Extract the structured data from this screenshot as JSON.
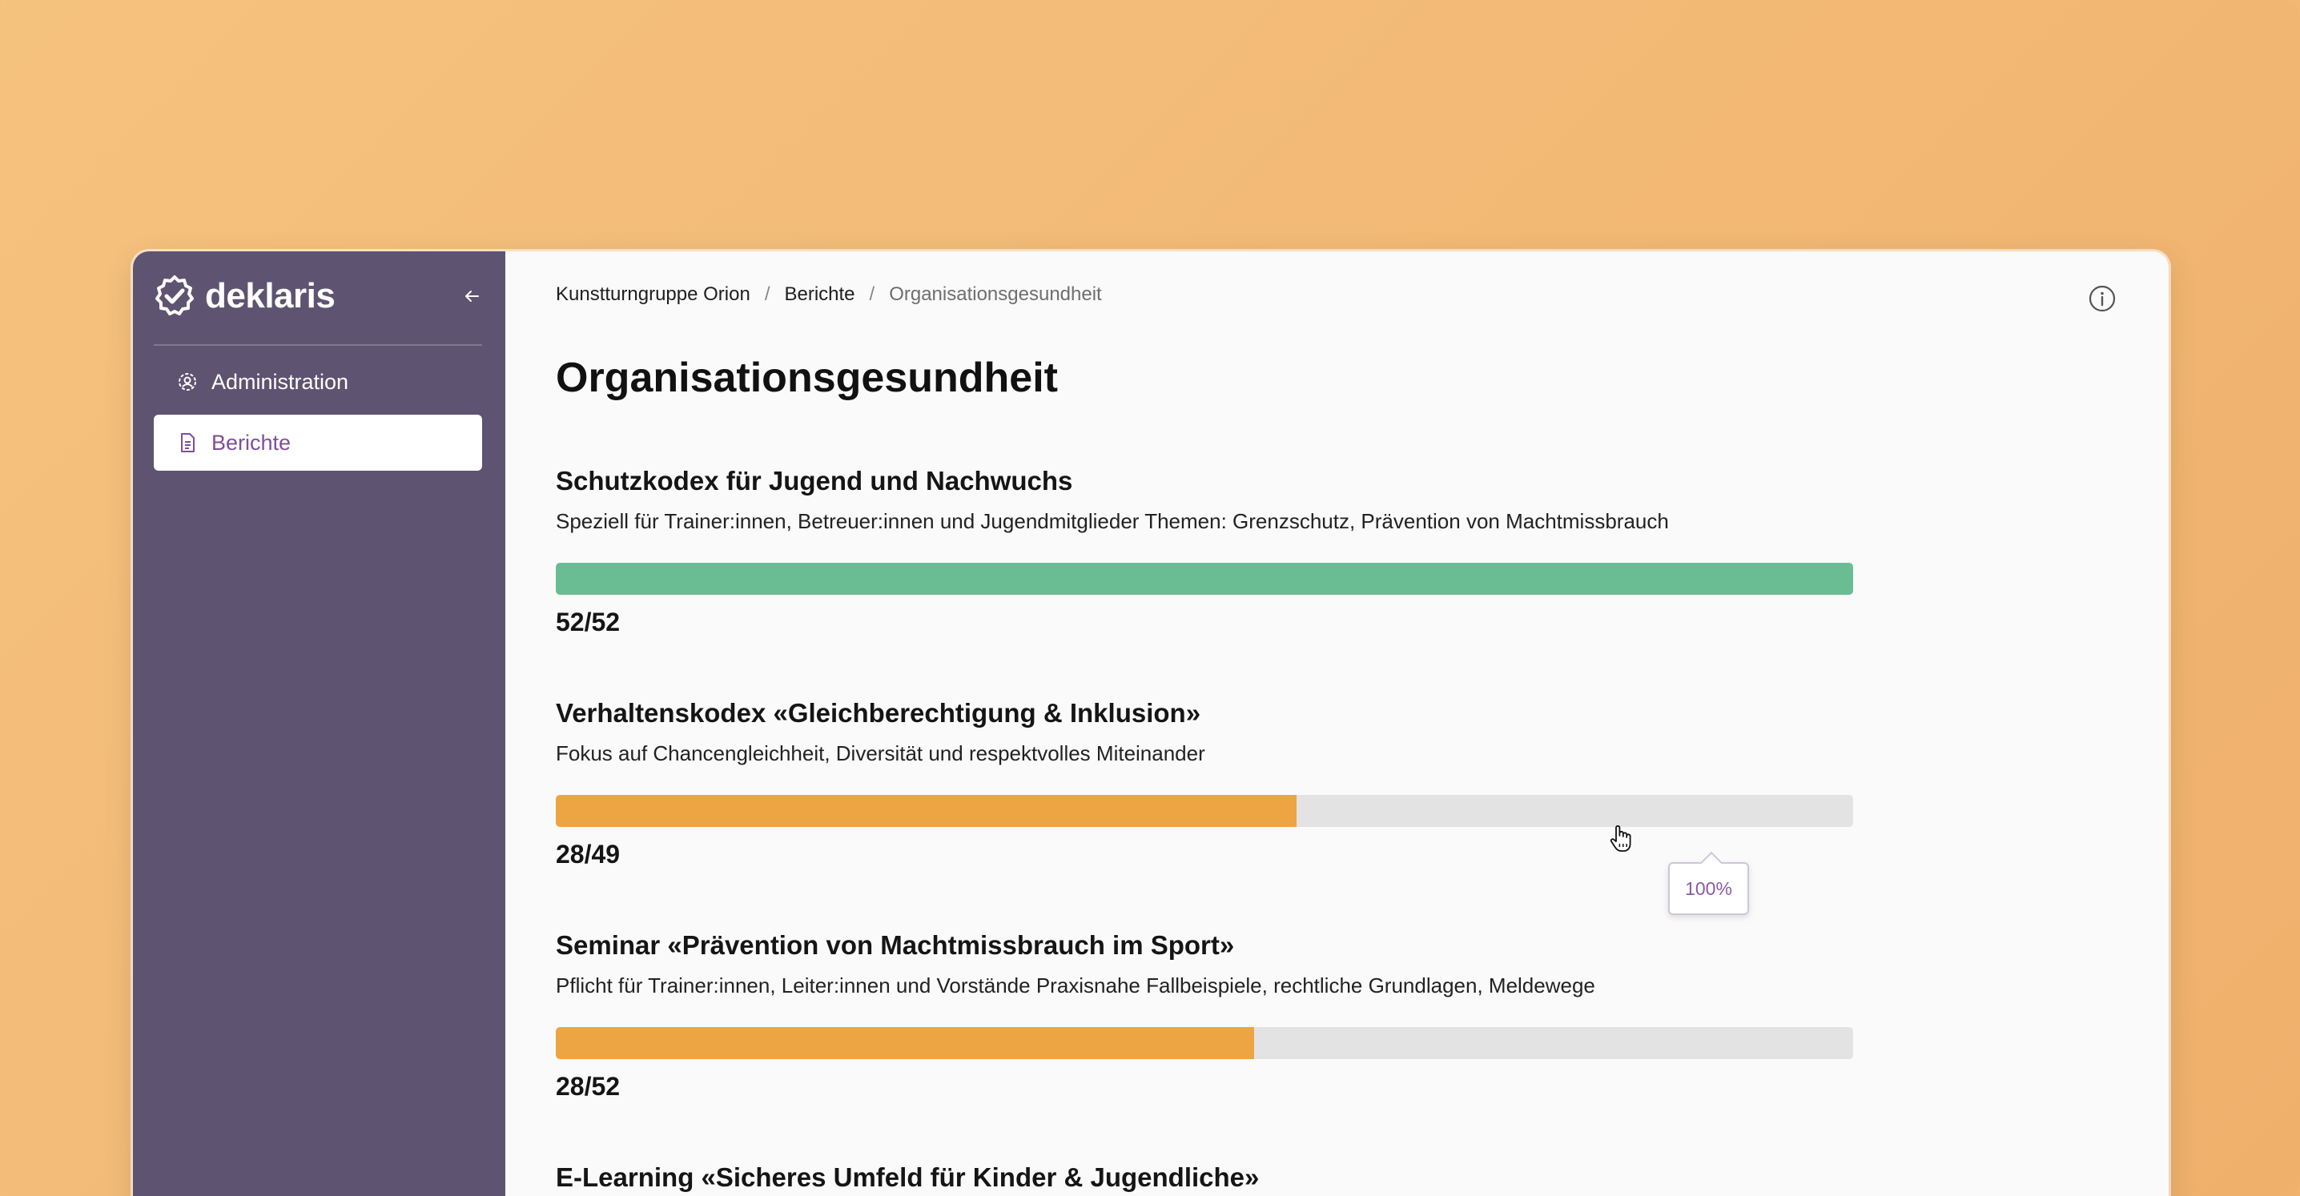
{
  "app": {
    "brand": "deklaris",
    "accent_color": "#7e4e9a",
    "sidebar_color": "#5e5471"
  },
  "sidebar": {
    "collapse_icon": "arrow-left-icon",
    "items": [
      {
        "label": "Administration",
        "icon": "admin-gear-icon",
        "active": false
      },
      {
        "label": "Berichte",
        "icon": "document-icon",
        "active": true
      }
    ]
  },
  "header": {
    "breadcrumb": [
      "Kunstturngruppe Orion",
      "Berichte",
      "Organisationsgesundheit"
    ],
    "info_icon": "info-icon"
  },
  "main": {
    "title": "Organisationsgesundheit",
    "reports": [
      {
        "title": "Schutzkodex für Jugend und Nachwuchs",
        "description": "Speziell für Trainer:innen, Betreuer:innen und Jugendmitglieder Themen: Grenzschutz, Prävention von Machtmissbrauch",
        "done": 52,
        "total": 52,
        "count_label": "52/52",
        "progress": 1.0,
        "color": "#6abd93"
      },
      {
        "title": "Verhaltenskodex «Gleichberechtigung & Inklusion»",
        "description": "Fokus auf Chancengleichheit, Diversität und respektvolles Miteinander",
        "done": 28,
        "total": 49,
        "count_label": "28/49",
        "progress": 0.571,
        "color": "#eda443"
      },
      {
        "title": "Seminar «Prävention von Machtmissbrauch im Sport»",
        "description": "Pflicht für Trainer:innen, Leiter:innen und Vorstände Praxisnahe Fallbeispiele, rechtliche Grundlagen, Meldewege",
        "done": 28,
        "total": 52,
        "count_label": "28/52",
        "progress": 0.538,
        "color": "#eda443"
      },
      {
        "title": "E-Learning «Sicheres Umfeld für Kinder & Jugendliche»"
      }
    ],
    "tooltip": "100%"
  }
}
